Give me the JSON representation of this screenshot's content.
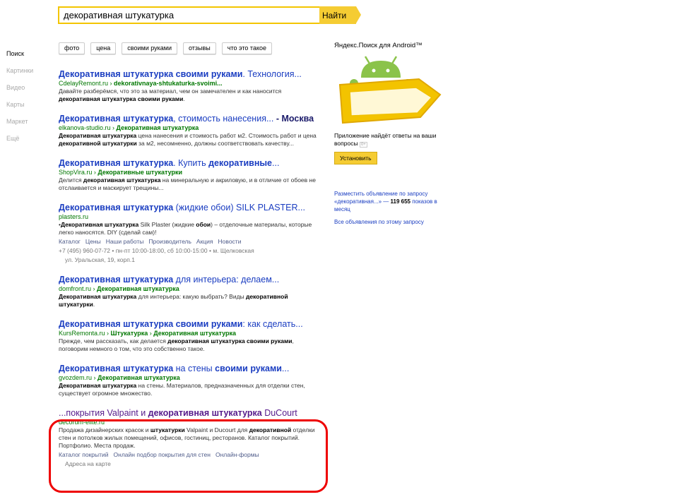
{
  "search": {
    "query": "декоративная штукатурка",
    "button": "Найти"
  },
  "nav": [
    "Поиск",
    "Картинки",
    "Видео",
    "Карты",
    "Маркет",
    "Ещё"
  ],
  "chips": [
    "фото",
    "цена",
    "своими руками",
    "отзывы",
    "что это такое"
  ],
  "results": [
    {
      "title_parts": [
        [
          "b",
          "Декоративная штукатурка своими руками"
        ],
        [
          "t",
          ". Технология..."
        ]
      ],
      "url_parts": [
        [
          "t",
          "CdelayRemont.ru"
        ],
        [
          "s",
          " › "
        ],
        [
          "b",
          "dekorativnaya-shtukaturka-svoimi..."
        ]
      ],
      "snippet": "Давайте разберёмся, что это за материал, чем он замечателен и как наносится <b>декоративная штукатурка своими руками</b>."
    },
    {
      "title_parts": [
        [
          "b",
          "Декоративная штукатурка"
        ],
        [
          "t",
          ", стоимость нанесения... "
        ],
        [
          "db",
          "- Москва"
        ]
      ],
      "url_parts": [
        [
          "t",
          "elkanova-studio.ru"
        ],
        [
          "s",
          " › "
        ],
        [
          "b",
          "Декоративная штукатурка"
        ]
      ],
      "snippet": "<b>Декоративная штукатурка</b> цена нанесения и стоимость работ м2. Стоимость работ и цена <b>декоративной штукатурки</b> за м2, несомненно, должны соответствовать качеству..."
    },
    {
      "title_parts": [
        [
          "b",
          "Декоративная штукатурка"
        ],
        [
          "t",
          ". Купить "
        ],
        [
          "b",
          "декоративные"
        ],
        [
          "t",
          "..."
        ]
      ],
      "url_parts": [
        [
          "t",
          "ShopVira.ru"
        ],
        [
          "s",
          " › "
        ],
        [
          "b",
          "Декоративные штукатурки"
        ]
      ],
      "snippet": "Делится <b>декоративная штукатурка</b> на минеральную и акриловую, и в отличие от обоев не отслаивается и маскирует трещины..."
    },
    {
      "title_parts": [
        [
          "b",
          "Декоративная штукатурка"
        ],
        [
          "t",
          " (жидкие обои) SILK PLASTER..."
        ]
      ],
      "url_parts": [
        [
          "t",
          "plasters.ru"
        ]
      ],
      "snippet": "•<b>Декоративная штукатурка</b> Silk Plaster (жидкие <b>обои</b>) – отделочные материалы, которые легко наносятся. DIY (сделай сам)!",
      "links": [
        "Каталог",
        "Цены",
        "Наши работы",
        "Производитель",
        "Акция",
        "Новости"
      ],
      "meta": "+7 (495) 960-07-72  •  пн-пт 10:00-18:00, сб 10:00-15:00  •  м. Щелковская",
      "addr": "ул. Уральская, 19, корп.1"
    },
    {
      "title_parts": [
        [
          "b",
          "Декоративная штукатурка"
        ],
        [
          "t",
          " для интерьера: делаем..."
        ]
      ],
      "url_parts": [
        [
          "t",
          "domfront.ru"
        ],
        [
          "s",
          " › "
        ],
        [
          "b",
          "Декоративная штукатурка"
        ]
      ],
      "snippet": "<b>Декоративная штукатурка</b> для интерьера: какую выбрать? Виды <b>декоративной штукатурки</b>."
    },
    {
      "title_parts": [
        [
          "b",
          "Декоративная штукатурка своими руками"
        ],
        [
          "t",
          ": как сделать..."
        ]
      ],
      "url_parts": [
        [
          "t",
          "KursRemonta.ru"
        ],
        [
          "s",
          " › "
        ],
        [
          "b",
          "Штукатурка"
        ],
        [
          "s",
          " › "
        ],
        [
          "b",
          "Декоративная штукатурка"
        ]
      ],
      "snippet": "Прежде, чем рассказать, как делается <b>декоративная штукатурка своими руками</b>, поговорим немного о том, что это собственно такое."
    },
    {
      "title_parts": [
        [
          "b",
          "Декоративная штукатурка"
        ],
        [
          "t",
          " на стены "
        ],
        [
          "b",
          "своими руками"
        ],
        [
          "t",
          "..."
        ]
      ],
      "url_parts": [
        [
          "t",
          "gvozdem.ru"
        ],
        [
          "s",
          " › "
        ],
        [
          "b",
          "Декоративная штукатурка"
        ]
      ],
      "snippet": "<b>Декоративная штукатурка</b> на стены. Материалов, предназначенных для отделки стен, существует огромное множество."
    },
    {
      "visited": true,
      "title_parts": [
        [
          "t",
          "...покрытия Valpaint и "
        ],
        [
          "b",
          "декоративная штукатурка"
        ],
        [
          "t",
          " DuCourt"
        ]
      ],
      "url_parts": [
        [
          "t",
          "decorum-elite.ru"
        ]
      ],
      "snippet": "Продажа дизайнерских красок и <b>штукатурки</b> Valpaint и Ducourt для <b>декоративной</b> отделки стен и потолков жилых помещений, офисов, гостиниц, ресторанов. Каталог покрытий. Портфолио. Места продаж.",
      "links": [
        "Каталог покрытий",
        "Онлайн подбор покрытия для стен",
        "Онлайн-формы"
      ],
      "addr": "Адреса на карте"
    }
  ],
  "promo": {
    "title": "Яндекс.Поиск для Android™",
    "text": "Приложение найдёт ответы на ваши вопросы",
    "age": "0+",
    "button": "Установить",
    "colors": {
      "yellow": "#f5cc33",
      "android_green": "#8bc34a"
    }
  },
  "ads": {
    "place_prefix": "Разместить объявление по запросу «декоративная...» — ",
    "place_count": "119 655",
    "place_suffix": " показов в месяц",
    "all": "Все объявления по этому запросу"
  }
}
